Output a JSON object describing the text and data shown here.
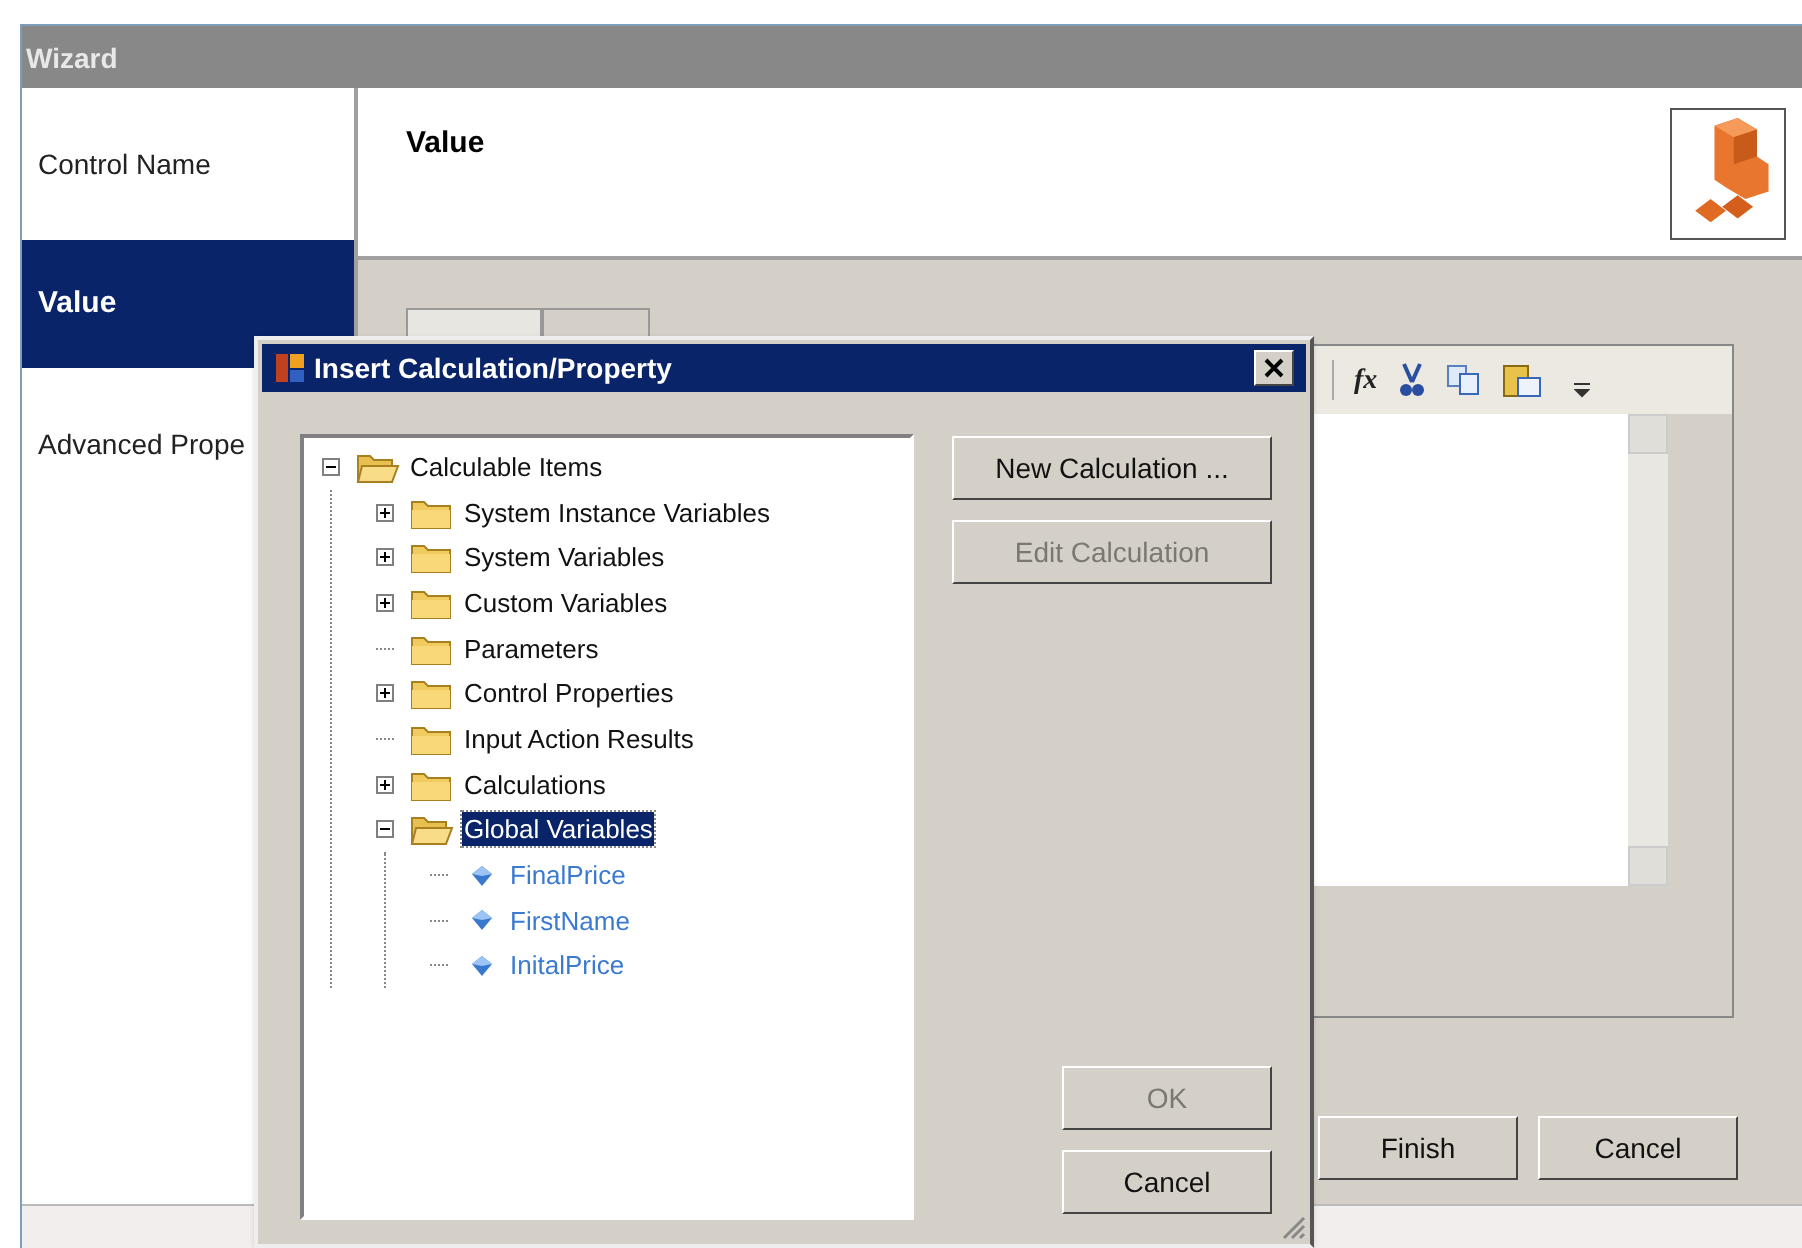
{
  "window": {
    "title": "Wizard"
  },
  "sidebar": {
    "items": [
      {
        "label": "Control Name",
        "selected": false
      },
      {
        "label": "Value",
        "selected": true
      },
      {
        "label": "Advanced Prope",
        "selected": false
      }
    ]
  },
  "header": {
    "title": "Value"
  },
  "editor": {
    "function_button": "fx"
  },
  "buttons": [
    "Finish",
    "Cancel"
  ],
  "dialog": {
    "title": "Insert Calculation/Property",
    "tree": [
      {
        "label": "Calculable Items",
        "kind": "folder",
        "expandable": true,
        "expanded": true,
        "selected": false,
        "children": [
          {
            "label": "System Instance Variables",
            "kind": "folder",
            "expandable": true,
            "expanded": false,
            "selected": false
          },
          {
            "label": "System Variables",
            "kind": "folder",
            "expandable": true,
            "expanded": false,
            "selected": false
          },
          {
            "label": "Custom Variables",
            "kind": "folder",
            "expandable": true,
            "expanded": false,
            "selected": false
          },
          {
            "label": "Parameters",
            "kind": "folder",
            "expandable": false,
            "expanded": false,
            "selected": false
          },
          {
            "label": "Control Properties",
            "kind": "folder",
            "expandable": true,
            "expanded": false,
            "selected": false
          },
          {
            "label": "Input Action Results",
            "kind": "folder",
            "expandable": false,
            "expanded": false,
            "selected": false
          },
          {
            "label": "Calculations",
            "kind": "folder",
            "expandable": true,
            "expanded": false,
            "selected": false
          },
          {
            "label": "Global Variables",
            "kind": "folder",
            "expandable": true,
            "expanded": true,
            "selected": true,
            "children": [
              {
                "label": "FinalPrice",
                "kind": "variable",
                "selected": false
              },
              {
                "label": "FirstName",
                "kind": "variable",
                "selected": false
              },
              {
                "label": "InitalPrice",
                "kind": "variable",
                "selected": false
              }
            ]
          }
        ]
      }
    ],
    "side_buttons": [
      {
        "label": "New Calculation ...",
        "disabled": false
      },
      {
        "label": "Edit Calculation",
        "disabled": true
      }
    ],
    "bottom_buttons": [
      {
        "label": "OK",
        "disabled": true
      },
      {
        "label": "Cancel",
        "disabled": false
      }
    ]
  }
}
